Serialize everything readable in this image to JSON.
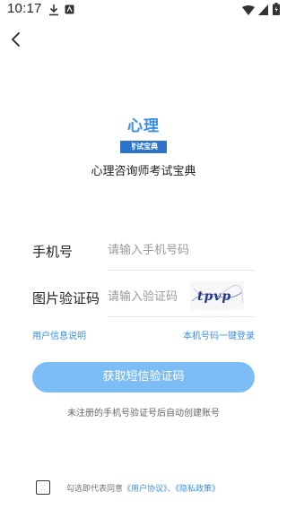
{
  "status_bar": {
    "time": "10:17",
    "icons": [
      "download-icon",
      "notification-icon",
      "wifi-icon",
      "signal-icon",
      "battery-icon"
    ]
  },
  "nav": {
    "back_icon": "chevron-left-icon"
  },
  "logo": {
    "title": "心理",
    "badge": "考试宝典"
  },
  "app_name": "心理咨询师考试宝典",
  "form": {
    "phone": {
      "label": "手机号",
      "value": "",
      "placeholder": "请输入手机号码"
    },
    "captcha": {
      "label": "图片验证码",
      "value": "",
      "placeholder": "请输入验证码",
      "image_text": "tpvp"
    }
  },
  "links": {
    "user_info": "用户信息说明",
    "one_click_login": "本机号码一键登录"
  },
  "get_code_button": "获取短信验证码",
  "hint": "未注册的手机号验证号后自动创建账号",
  "agreement": {
    "checked": false,
    "prefix": "勾选即代表同意",
    "user_agreement": "《用户协议》",
    "separator": "、",
    "privacy_policy": "《隐私政策》"
  },
  "colors": {
    "accent": "#3a8ee6",
    "button": "#7dbdf5",
    "badge": "#2e74c9"
  }
}
